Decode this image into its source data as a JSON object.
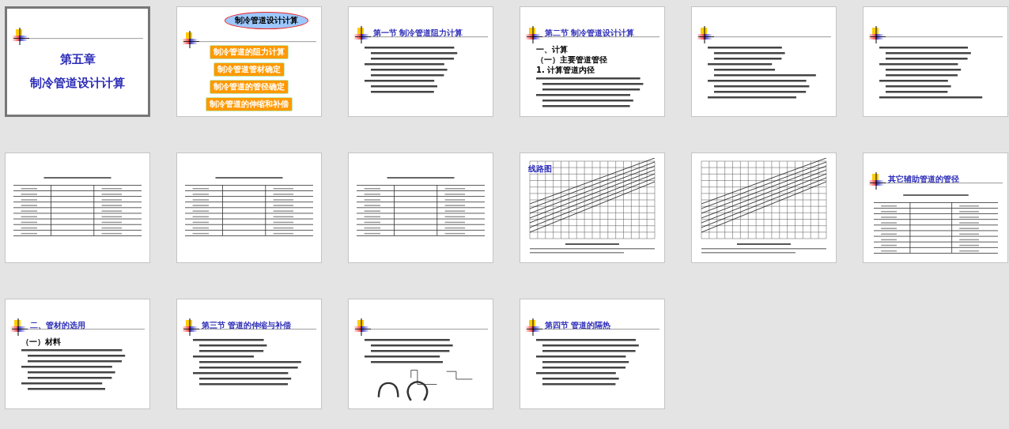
{
  "slides": [
    {
      "kind": "title",
      "selected": true,
      "title_lines": [
        "第五章",
        "制冷管道设计计算"
      ]
    },
    {
      "kind": "agenda",
      "selected": false,
      "callout": "制冷管道设计计算",
      "items": [
        "制冷管道的阻力计算",
        "制冷管道管材确定",
        "制冷管道的管径确定",
        "制冷管道的伸缩和补偿"
      ]
    },
    {
      "kind": "text",
      "selected": false,
      "heading": "第一节 制冷管道阻力计算"
    },
    {
      "kind": "text",
      "selected": false,
      "heading": "第二节 制冷管道设计计算",
      "lines": [
        "一、计算",
        "（一）主要管道管径",
        "1. 计算管道内径"
      ]
    },
    {
      "kind": "text",
      "selected": false
    },
    {
      "kind": "text",
      "selected": false
    },
    {
      "kind": "table",
      "selected": false
    },
    {
      "kind": "table",
      "selected": false
    },
    {
      "kind": "table",
      "selected": false
    },
    {
      "kind": "chart",
      "selected": false,
      "label": "线路图"
    },
    {
      "kind": "chart",
      "selected": false
    },
    {
      "kind": "table",
      "selected": false,
      "heading": "其它辅助管道的管径"
    },
    {
      "kind": "text",
      "selected": false,
      "heading": "二、管材的选用",
      "lines": [
        "（一）材料"
      ]
    },
    {
      "kind": "text",
      "selected": false,
      "heading": "第三节 管道的伸缩与补偿"
    },
    {
      "kind": "figure",
      "selected": false
    },
    {
      "kind": "text",
      "selected": false,
      "heading": "第四节 管道的隔热"
    }
  ]
}
